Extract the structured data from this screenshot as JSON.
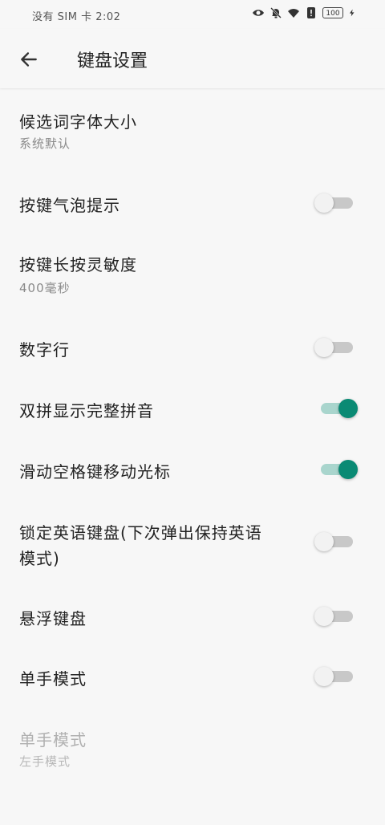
{
  "status_bar": {
    "carrier_time": "没有 SIM 卡 2:02",
    "battery": "100",
    "icons": [
      "eye-icon",
      "bell-off-icon",
      "wifi-icon",
      "alert-icon",
      "battery-icon",
      "charging-icon"
    ]
  },
  "app_bar": {
    "title": "键盘设置",
    "back_icon": "arrow-left-icon"
  },
  "settings": {
    "candidate_font": {
      "label": "候选词字体大小",
      "value": "系统默认"
    },
    "key_popup": {
      "label": "按键气泡提示",
      "enabled": false
    },
    "long_press": {
      "label": "按键长按灵敏度",
      "value": "400毫秒"
    },
    "number_row": {
      "label": "数字行",
      "enabled": false
    },
    "shuangpin_full": {
      "label": "双拼显示完整拼音",
      "enabled": true
    },
    "space_cursor": {
      "label": "滑动空格键移动光标",
      "enabled": true
    },
    "lock_english": {
      "label_line1": "锁定英语键盘(下次弹出保持英语",
      "label_line2": "模式)",
      "enabled": false
    },
    "floating": {
      "label": "悬浮键盘",
      "enabled": false
    },
    "one_hand": {
      "label": "单手模式",
      "enabled": false
    },
    "one_hand_side": {
      "label": "单手模式",
      "value": "左手模式"
    }
  },
  "colors": {
    "accent": "#0a8a74",
    "accent_track": "#a9d5cd",
    "toggle_off_track": "#c8c8c8",
    "background": "#f7f7f7"
  }
}
